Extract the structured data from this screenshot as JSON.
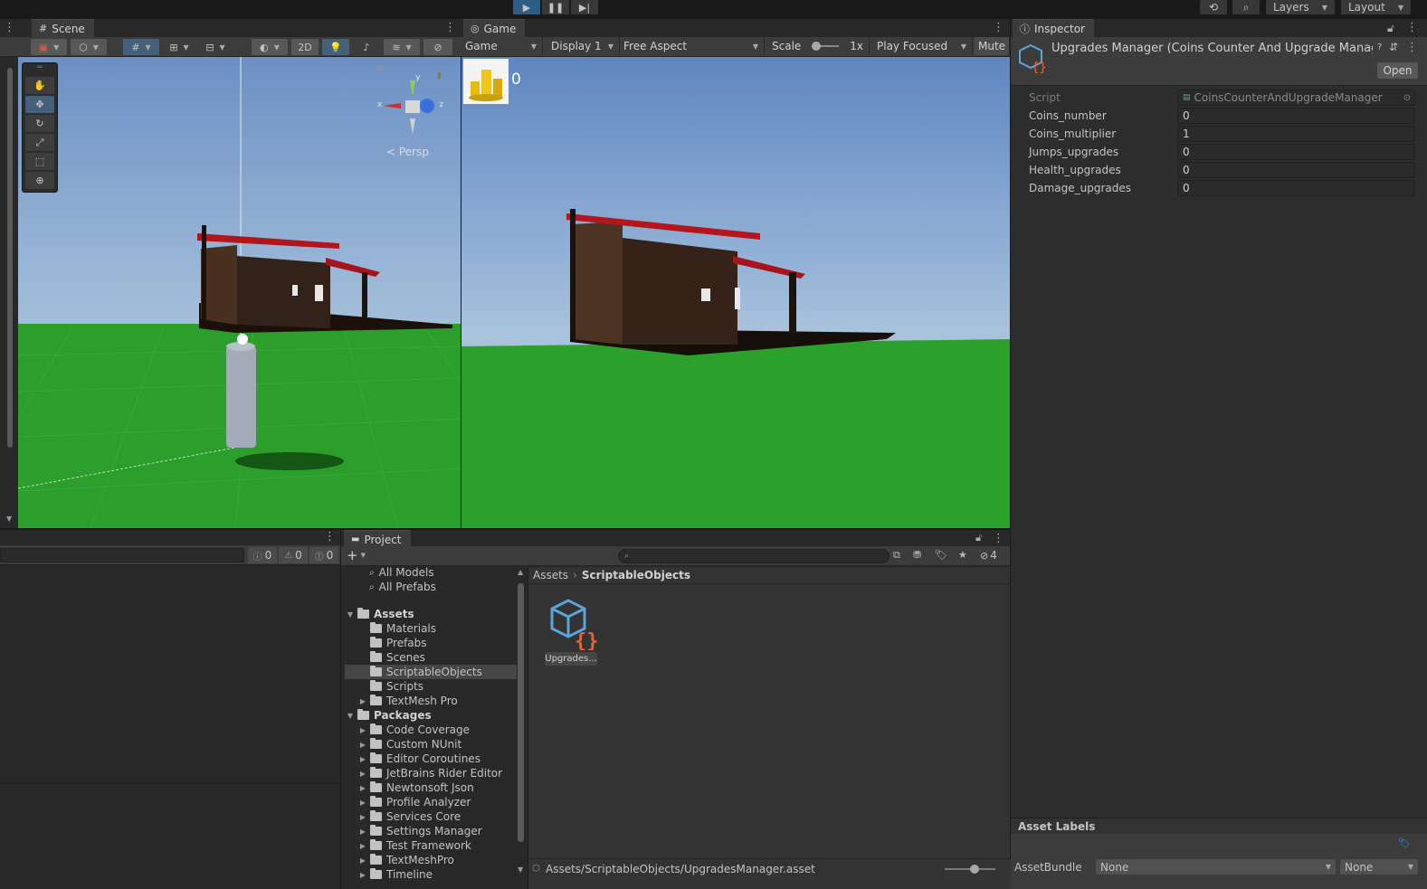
{
  "topbar": {
    "play_icon": "play-icon",
    "pause_icon": "pause-icon",
    "step_icon": "step-icon",
    "history_icon": "history-icon",
    "search_icon": "search-icon",
    "layers_label": "Layers",
    "layout_label": "Layout"
  },
  "scene": {
    "tab_label": "Scene",
    "mode_2d_label": "2D",
    "persp_label": "< Persp",
    "gizmo_axes": {
      "x": "x",
      "y": "y",
      "z": "z"
    }
  },
  "game": {
    "tab_label": "Game",
    "view_dropdown": "Game",
    "display_dropdown": "Display 1",
    "aspect_dropdown": "Free Aspect",
    "scale_label": "Scale",
    "scale_value": "1x",
    "play_focused_dropdown": "Play Focused",
    "mute_label": "Mute A",
    "coin_count": "0"
  },
  "inspector": {
    "tab_label": "Inspector",
    "object_title": "Upgrades Manager (Coins Counter And Upgrade Manage",
    "open_button": "Open",
    "properties": [
      {
        "label": "Script",
        "value": "CoinsCounterAndUpgradeManager"
      },
      {
        "label": "Coins_number",
        "value": "0"
      },
      {
        "label": "Coins_multiplier",
        "value": "1"
      },
      {
        "label": "Jumps_upgrades",
        "value": "0"
      },
      {
        "label": "Health_upgrades",
        "value": "0"
      },
      {
        "label": "Damage_upgrades",
        "value": "0"
      }
    ],
    "asset_labels_title": "Asset Labels",
    "assetbundle_label": "AssetBundle",
    "assetbundle_value": "None",
    "assetbundle_variant": "None"
  },
  "console": {
    "errors_count": "0",
    "warnings_count": "0",
    "messages_count": "0"
  },
  "project": {
    "tab_label": "Project",
    "add_label": "+",
    "hidden_count": "4",
    "favorites": [
      "All Models",
      "All Prefabs"
    ],
    "assets_root": "Assets",
    "assets_children": [
      "Materials",
      "Prefabs",
      "Scenes",
      "ScriptableObjects",
      "Scripts",
      "TextMesh Pro"
    ],
    "packages_root": "Packages",
    "packages_children": [
      "Code Coverage",
      "Custom NUnit",
      "Editor Coroutines",
      "JetBrains Rider Editor",
      "Newtonsoft Json",
      "Profile Analyzer",
      "Services Core",
      "Settings Manager",
      "Test Framework",
      "TextMeshPro",
      "Timeline"
    ],
    "breadcrumb_root": "Assets",
    "breadcrumb_current": "ScriptableObjects",
    "asset_tile_label": "Upgrades...",
    "status_path": "Assets/ScriptableObjects/UpgradesManager.asset"
  }
}
